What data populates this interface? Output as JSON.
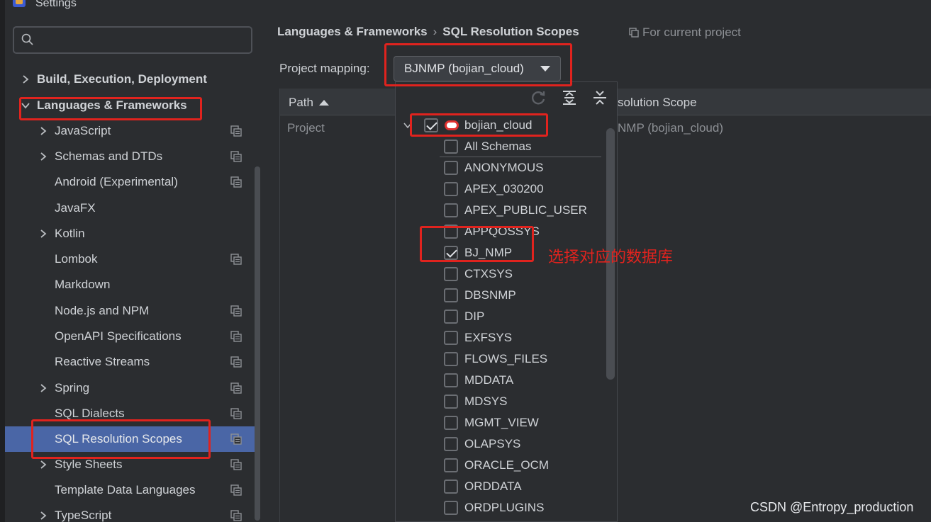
{
  "window": {
    "title": "Settings"
  },
  "search": {
    "placeholder": ""
  },
  "sidebar": {
    "items": [
      {
        "label": "Build, Execution, Deployment",
        "bold": true,
        "expandable": true,
        "expanded": false,
        "level": 0,
        "project_icon": false
      },
      {
        "label": "Languages & Frameworks",
        "bold": true,
        "expandable": true,
        "expanded": true,
        "level": 0,
        "project_icon": false
      },
      {
        "label": "JavaScript",
        "expandable": true,
        "level": 1,
        "project_icon": true
      },
      {
        "label": "Schemas and DTDs",
        "expandable": true,
        "level": 1,
        "project_icon": true
      },
      {
        "label": "Android (Experimental)",
        "expandable": false,
        "level": 1,
        "project_icon": true
      },
      {
        "label": "JavaFX",
        "expandable": false,
        "level": 1,
        "project_icon": false
      },
      {
        "label": "Kotlin",
        "expandable": true,
        "level": 1,
        "project_icon": false
      },
      {
        "label": "Lombok",
        "expandable": false,
        "level": 1,
        "project_icon": true
      },
      {
        "label": "Markdown",
        "expandable": false,
        "level": 1,
        "project_icon": false
      },
      {
        "label": "Node.js and NPM",
        "expandable": false,
        "level": 1,
        "project_icon": true
      },
      {
        "label": "OpenAPI Specifications",
        "expandable": false,
        "level": 1,
        "project_icon": true
      },
      {
        "label": "Reactive Streams",
        "expandable": false,
        "level": 1,
        "project_icon": true
      },
      {
        "label": "Spring",
        "expandable": true,
        "level": 1,
        "project_icon": true
      },
      {
        "label": "SQL Dialects",
        "expandable": false,
        "level": 1,
        "project_icon": true
      },
      {
        "label": "SQL Resolution Scopes",
        "expandable": false,
        "level": 1,
        "project_icon": true,
        "selected": true
      },
      {
        "label": "Style Sheets",
        "expandable": true,
        "level": 1,
        "project_icon": true
      },
      {
        "label": "Template Data Languages",
        "expandable": false,
        "level": 1,
        "project_icon": true
      },
      {
        "label": "TypeScript",
        "expandable": true,
        "level": 1,
        "project_icon": true
      }
    ]
  },
  "main": {
    "breadcrumb": [
      "Languages & Frameworks",
      "SQL Resolution Scopes"
    ],
    "breadcrumb_sep": "›",
    "for_project": "For current project",
    "mapping_label": "Project mapping:",
    "mapping_value": "BJNMP (bojian_cloud)",
    "table": {
      "col_path": "Path",
      "col_scope": "Resolution Scope",
      "col_scope_visible": "solution Scope",
      "rows": [
        {
          "path": "Project",
          "scope_visible": "NMP (bojian_cloud)"
        }
      ]
    }
  },
  "popup": {
    "root": {
      "label": "bojian_cloud",
      "checked": true
    },
    "schemas": [
      {
        "label": "All Schemas",
        "checked": false
      },
      {
        "label": "ANONYMOUS",
        "checked": false
      },
      {
        "label": "APEX_030200",
        "checked": false
      },
      {
        "label": "APEX_PUBLIC_USER",
        "checked": false
      },
      {
        "label": "APPQOSSYS",
        "checked": false
      },
      {
        "label": "BJ_NMP",
        "checked": true
      },
      {
        "label": "CTXSYS",
        "checked": false
      },
      {
        "label": "DBSNMP",
        "checked": false
      },
      {
        "label": "DIP",
        "checked": false
      },
      {
        "label": "EXFSYS",
        "checked": false
      },
      {
        "label": "FLOWS_FILES",
        "checked": false
      },
      {
        "label": "MDDATA",
        "checked": false
      },
      {
        "label": "MDSYS",
        "checked": false
      },
      {
        "label": "MGMT_VIEW",
        "checked": false
      },
      {
        "label": "OLAPSYS",
        "checked": false
      },
      {
        "label": "ORACLE_OCM",
        "checked": false
      },
      {
        "label": "ORDDATA",
        "checked": false
      },
      {
        "label": "ORDPLUGINS",
        "checked": false
      }
    ]
  },
  "annotation": "选择对应的数据库",
  "watermark": "CSDN @Entropy_production",
  "colors": {
    "selection": "#4a66a6",
    "highlight": "#e0231e",
    "background": "#2b2d30"
  }
}
